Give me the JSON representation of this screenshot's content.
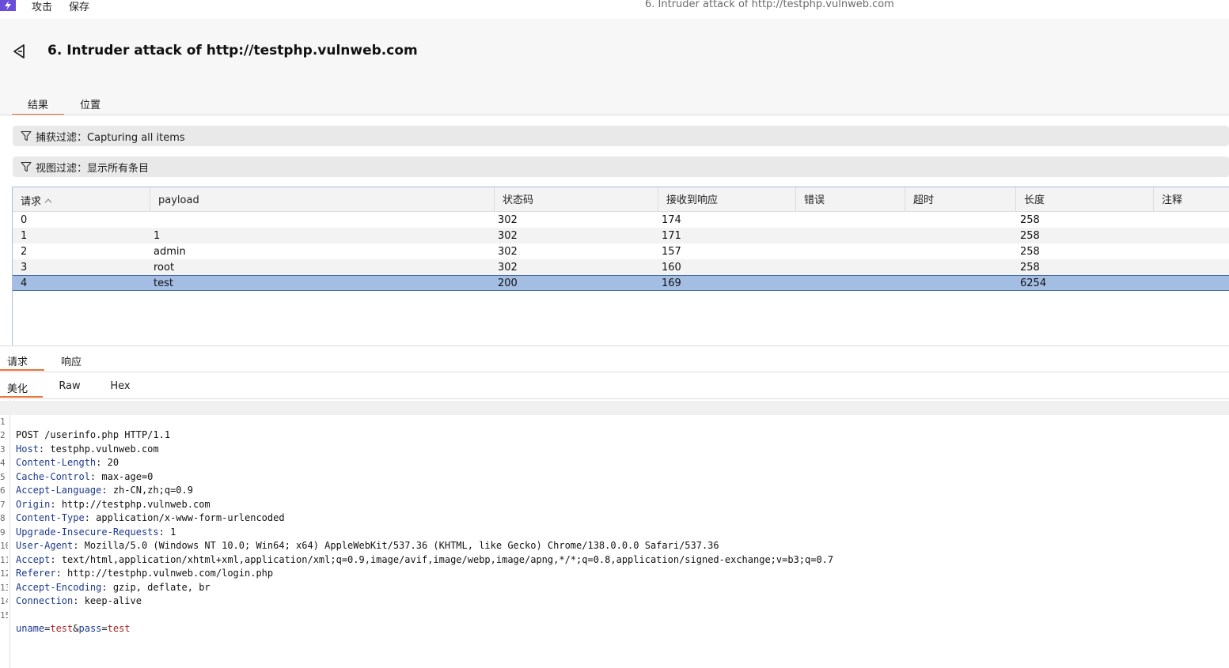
{
  "menubar": {
    "items": [
      "攻击",
      "保存"
    ],
    "window_title": "6. Intruder attack of http://testphp.vulnweb.com"
  },
  "header": {
    "title": "6. Intruder attack of http://testphp.vulnweb.com",
    "tabs": [
      "结果",
      "位置"
    ],
    "active_tab": "结果"
  },
  "filters": {
    "capture": "捕获过滤：Capturing all items",
    "view": "视图过滤：显示所有条目"
  },
  "table": {
    "columns": [
      "请求",
      "payload",
      "状态码",
      "接收到响应",
      "错误",
      "超时",
      "长度",
      "注释"
    ],
    "sorted_column": "请求",
    "rows": [
      {
        "request": "0",
        "payload": "",
        "status": "302",
        "received": "174",
        "error": "",
        "timeout": "",
        "length": "258",
        "comment": ""
      },
      {
        "request": "1",
        "payload": "1",
        "status": "302",
        "received": "171",
        "error": "",
        "timeout": "",
        "length": "258",
        "comment": ""
      },
      {
        "request": "2",
        "payload": "admin",
        "status": "302",
        "received": "157",
        "error": "",
        "timeout": "",
        "length": "258",
        "comment": ""
      },
      {
        "request": "3",
        "payload": "root",
        "status": "302",
        "received": "160",
        "error": "",
        "timeout": "",
        "length": "258",
        "comment": ""
      },
      {
        "request": "4",
        "payload": "test",
        "status": "200",
        "received": "169",
        "error": "",
        "timeout": "",
        "length": "6254",
        "comment": ""
      }
    ],
    "selected_row": 4
  },
  "detail": {
    "tabs": [
      "请求",
      "响应"
    ],
    "active_tab": "请求",
    "view_tabs": [
      "美化",
      "Raw",
      "Hex"
    ],
    "active_view": "美化"
  },
  "editor": {
    "request_line": "POST /userinfo.php HTTP/1.1",
    "headers": [
      {
        "name": "Host",
        "value": "testphp.vulnweb.com"
      },
      {
        "name": "Content-Length",
        "value": "20"
      },
      {
        "name": "Cache-Control",
        "value": "max-age=0"
      },
      {
        "name": "Accept-Language",
        "value": "zh-CN,zh;q=0.9"
      },
      {
        "name": "Origin",
        "value": "http://testphp.vulnweb.com"
      },
      {
        "name": "Content-Type",
        "value": "application/x-www-form-urlencoded"
      },
      {
        "name": "Upgrade-Insecure-Requests",
        "value": "1"
      },
      {
        "name": "User-Agent",
        "value": "Mozilla/5.0 (Windows NT 10.0; Win64; x64) AppleWebKit/537.36 (KHTML, like Gecko) Chrome/138.0.0.0 Safari/537.36"
      },
      {
        "name": "Accept",
        "value": "text/html,application/xhtml+xml,application/xml;q=0.9,image/avif,image/webp,image/apng,*/*;q=0.8,application/signed-exchange;v=b3;q=0.7"
      },
      {
        "name": "Referer",
        "value": "http://testphp.vulnweb.com/login.php"
      },
      {
        "name": "Accept-Encoding",
        "value": "gzip, deflate, br"
      },
      {
        "name": "Connection",
        "value": "keep-alive"
      }
    ],
    "body": [
      {
        "key": "uname",
        "value": "test"
      },
      {
        "key": "pass",
        "value": "test"
      }
    ]
  },
  "colors": {
    "accent": "#e8743b",
    "selection": "#a3bde3",
    "logo": "#6a4dd8"
  },
  "icons": [
    "app-logo-icon",
    "back-icon",
    "filter-icon",
    "sort-ascending-icon"
  ]
}
